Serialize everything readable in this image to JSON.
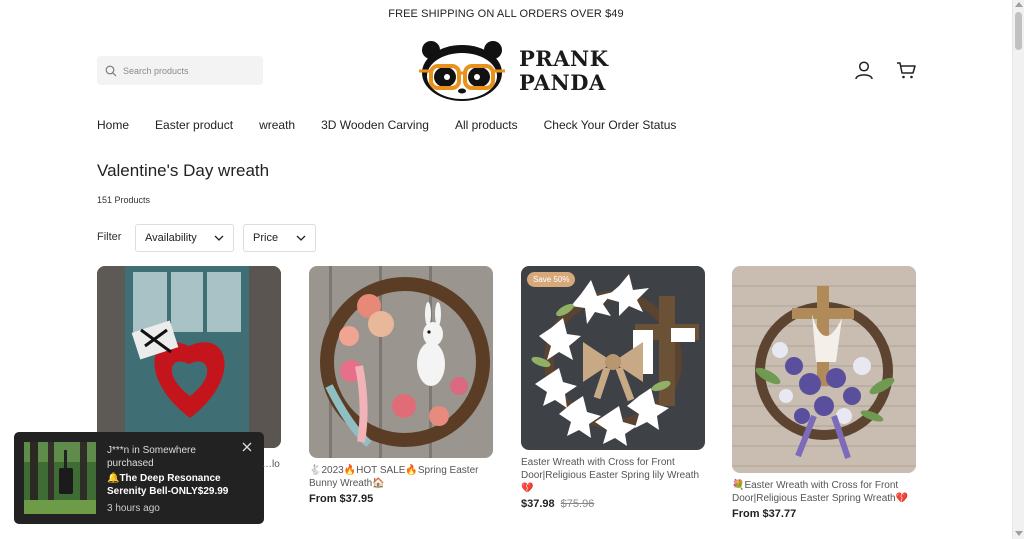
{
  "announcement": "FREE SHIPPING ON ALL ORDERS OVER $49",
  "search": {
    "placeholder": "Search products"
  },
  "brand": {
    "line1": "PRANK",
    "line2": "PANDA"
  },
  "nav": [
    "Home",
    "Easter product",
    "wreath",
    "3D Wooden Carving",
    "All products",
    "Check Your Order Status"
  ],
  "collection": {
    "title": "Valentine's Day wreath",
    "count": "151 Products"
  },
  "filters": {
    "label": "Filter",
    "availability": "Availability",
    "price": "Price"
  },
  "products": [
    {
      "title": "…lo",
      "price": "",
      "compare": "",
      "badge": ""
    },
    {
      "title": "🐇2023🔥HOT SALE🔥Spring Easter Bunny Wreath🏠",
      "price": "From $37.95",
      "compare": "",
      "badge": ""
    },
    {
      "title": "Easter Wreath with Cross for Front Door|Religious Easter Spring lily Wreath💔",
      "price": "$37.98",
      "compare": "$75.96",
      "badge": "Save 50%"
    },
    {
      "title": "💐Easter Wreath with Cross for Front Door|Religious Easter Spring Wreath💔",
      "price": "From $37.77",
      "compare": "",
      "badge": ""
    }
  ],
  "popup": {
    "message": "J***n in Somewhere purchased",
    "product": "🔔The Deep Resonance Serenity Bell-ONLY$29.99",
    "time": "3 hours ago"
  }
}
